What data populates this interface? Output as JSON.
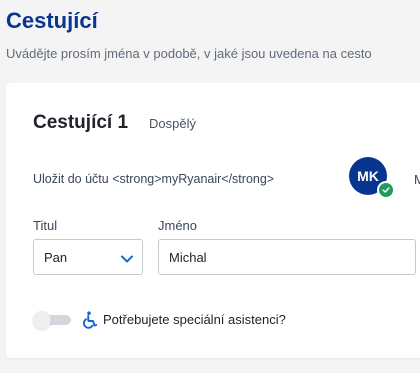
{
  "header": {
    "title": "Cestující",
    "subtitle": "Uvádějte prosím jména v podobě, v jaké jsou uvedena na cesto"
  },
  "passenger": {
    "title": "Cestující 1",
    "type_badge": "Dospělý",
    "save_to_account": "Uložit do účtu <strong>myRyanair</strong>",
    "avatar_initials": "MK",
    "avatar_name": "M",
    "title_label": "Titul",
    "title_value": "Pan",
    "name_label": "Jméno",
    "name_value": "Michal",
    "assist_label": "Potřebujete speciální asistenci?",
    "assist_enabled": false
  },
  "colors": {
    "brand_blue": "#073590",
    "accent_blue": "#1b66d6",
    "check_green": "#1e9e5a"
  },
  "icons": {
    "chevron": "chevron-down-icon",
    "check": "check-icon",
    "wheelchair": "wheelchair-icon"
  }
}
